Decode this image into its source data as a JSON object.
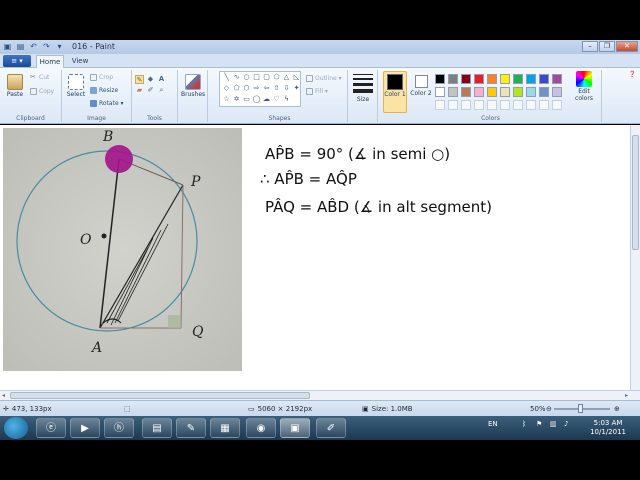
{
  "window": {
    "title": "016 - Paint",
    "controls": [
      "–",
      "❐",
      "✕"
    ]
  },
  "tabs": {
    "app_menu": "≡ ▾",
    "items": [
      "Home",
      "View"
    ]
  },
  "ribbon": {
    "clipboard": {
      "label": "Clipboard",
      "paste": "Paste",
      "cut": "Cut",
      "copy": "Copy"
    },
    "image": {
      "label": "Image",
      "select": "Select",
      "crop": "Crop",
      "resize": "Resize",
      "rotate": "Rotate ▾"
    },
    "tools": {
      "label": "Tools"
    },
    "brushes": {
      "label": "Brushes"
    },
    "shapes": {
      "label": "Shapes",
      "outline": "Outline ▾",
      "fill": "Fill ▾"
    },
    "size": {
      "label": "Size"
    },
    "colors": {
      "label": "Colors",
      "color1": "Color 1",
      "color2": "Color 2",
      "edit": "Edit colors",
      "color1_value": "#000000",
      "color2_value": "#ffffff",
      "palette": [
        "#000000",
        "#7f7f7f",
        "#880015",
        "#ed1c24",
        "#ff7f27",
        "#fff200",
        "#22b14c",
        "#00a2e8",
        "#3f48cc",
        "#a349a4",
        "#ffffff",
        "#c3c3c3",
        "#b97a57",
        "#ffaec9",
        "#ffc90e",
        "#efe4b0",
        "#b5e61d",
        "#99d9ea",
        "#7092be",
        "#c8bfe7"
      ]
    }
  },
  "canvas": {
    "photo_labels": {
      "B": "B",
      "P": "P",
      "O": "O",
      "A": "A",
      "Q": "Q"
    },
    "handwriting": [
      "AP̂B = 90° (∡ in semi ○)",
      "∴ AP̂B = AQ̂P",
      "PÂQ = AB̂D (∡ in alt segment)"
    ]
  },
  "status": {
    "cursor": "473, 133px",
    "dimensions": "5060 × 2192px",
    "size": "Size: 1.0MB",
    "zoom": "50%",
    "zoom_level": 0.5
  },
  "taskbar": {
    "lang": "EN",
    "time": "5:03 AM",
    "date": "10/1/2011"
  }
}
